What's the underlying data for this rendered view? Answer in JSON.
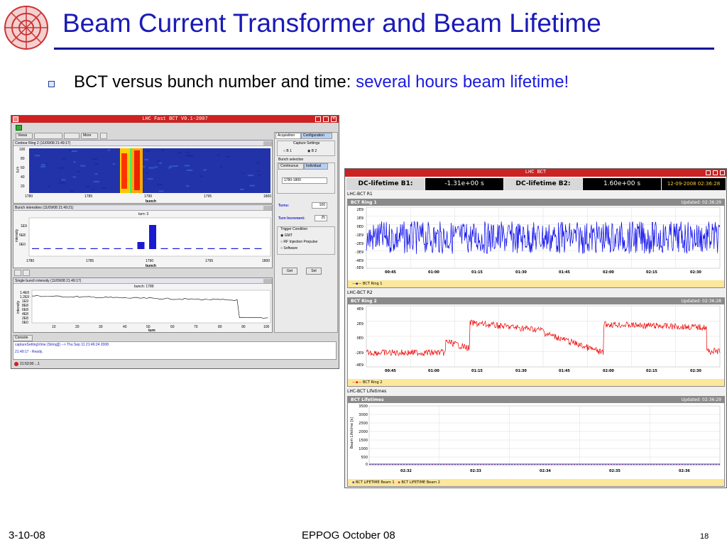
{
  "slide": {
    "title": "Beam Current Transformer and Beam Lifetime",
    "bullet_prefix": "BCT versus bunch number and time: ",
    "bullet_highlight": "several hours beam lifetime!",
    "footer_left": "3-10-08",
    "footer_center": "EPPOG October 08",
    "footer_right": "18",
    "title_color": "#1a1ab8"
  },
  "fastbct": {
    "window_title": "LHC Fast BCT V0.1-2007",
    "toolbar": {
      "views": "Views",
      "more": "More"
    },
    "panel1": {
      "title": "Contour Ring 2  (11/09/08 21:49:17)",
      "ylabel": "turn",
      "xlabel": "bunch",
      "yticks": [
        "100",
        "80",
        "60",
        "40",
        "20"
      ],
      "xticks": [
        "1780",
        "1785",
        "1790",
        "1795",
        "1800"
      ]
    },
    "panel2": {
      "title": "Bunch intensities  (11/09/08 21:49:21)",
      "subtitle": "turn: 3",
      "ylabel": "intensity",
      "xlabel": "bunch",
      "yticks": [
        "1E9",
        "5E8",
        "0E0"
      ],
      "xticks": [
        "1780",
        "1785",
        "1790",
        "1795",
        "1800"
      ]
    },
    "panel3": {
      "title": "Single bunch intensity  (11/09/08 21:49:17)",
      "subtitle": "bunch: 1789",
      "ylabel": "intensity",
      "xlabel": "turn",
      "yticks": [
        "1.4E9",
        "1.2E9",
        "1E9",
        "8E8",
        "6E8",
        "4E8",
        "2E8",
        "0E0"
      ],
      "xticks": [
        "10",
        "20",
        "30",
        "40",
        "50",
        "60",
        "70",
        "80",
        "90",
        "100"
      ]
    },
    "right": {
      "tabs": [
        "Acquisition",
        "Configuration"
      ],
      "capture_settings": "Capture Settings",
      "radio_b1": "B 1",
      "radio_b2": "B 2",
      "bunch_selection": "Bunch selection",
      "subtabs": [
        "Continuous",
        "Individual"
      ],
      "bunch_range": "1780-1800",
      "turns_label": "Turns:",
      "turns_value": "100",
      "increment_label": "Turn Increment:",
      "increment_value": "25",
      "trigger_condition": "Trigger Condition",
      "trig1": "GMT",
      "trig2": "RF Injection Prepulse",
      "trig3": "Software",
      "get": "Get",
      "set": "Set"
    },
    "console": {
      "tab": "Console",
      "line1": "captureSettingVime (String[]) --> Thu Sep 11 21:49:24 2008",
      "line2": "21:49:17 - Ready."
    },
    "status": "21:53:00 ...1"
  },
  "lhcbct": {
    "window_title": "LHC BCT",
    "b1_label": "DC-lifetime B1:",
    "b1_value": "-1.31e+00 s",
    "b2_label": "DC-lifetime B2:",
    "b2_value": "1.60e+00 s",
    "datetime": "12-09-2008 02:36:28",
    "sec1": "LHC-BCT R1",
    "p1_title": "BCT Ring 1",
    "p1_updated": "Updated: 02:36:29",
    "p1_yticks": [
      "2E9",
      "1E9",
      "0E0",
      "-1E9",
      "-2E9",
      "-3E9",
      "-4E9",
      "-5E9"
    ],
    "p1_xticks": [
      "00:45",
      "01:00",
      "01:15",
      "01:30",
      "01:45",
      "02:00",
      "02:15",
      "02:30"
    ],
    "p1_legend": "BCT Ring 1",
    "sec2": "LHC-BCT R2",
    "p2_title": "BCT Ring 2",
    "p2_updated": "Updated: 02:36:28",
    "p2_yticks": [
      "4E9",
      "2E9",
      "0E0",
      "-2E9",
      "-4E9"
    ],
    "p2_xticks": [
      "00:45",
      "01:00",
      "01:15",
      "01:30",
      "01:45",
      "02:00",
      "02:15",
      "02:30"
    ],
    "p2_legend": "BCT Ring 2",
    "sec3": "LHC-BCT Lifetimes",
    "p3_title": "BCT Lifetimes",
    "p3_updated": "Updated: 02:36:29",
    "p3_ylabel": "Beam Lifetime [s]",
    "p3_yticks": [
      "3500",
      "3000",
      "2500",
      "2000",
      "1500",
      "1000",
      "500",
      "0"
    ],
    "p3_xticks": [
      "02:32",
      "02:33",
      "02:34",
      "02:35",
      "02:36"
    ],
    "p3_legend1": "BCT LIFETIME Beam 1",
    "p3_legend2": "BCT LIFETIME Beam 2",
    "colors": {
      "ring1": "#0000ee",
      "ring2": "#ee0000",
      "title_bar": "#cc2222",
      "legend_bg": "#fce79a"
    }
  }
}
